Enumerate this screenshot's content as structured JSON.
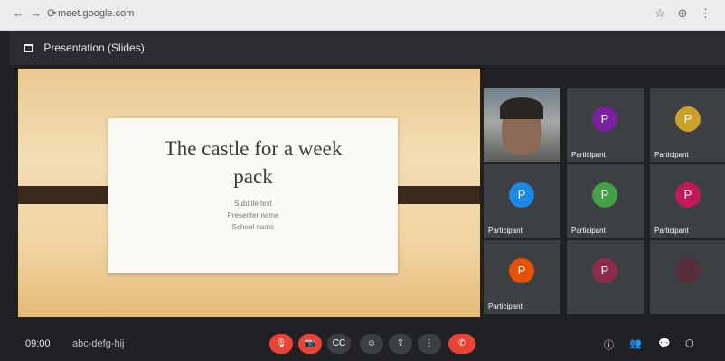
{
  "meet": {
    "presenting_label": "Presentation (Slides)",
    "slide": {
      "title_line1": "The castle for a week",
      "title_line2": "pack",
      "line1": "Subtitle text",
      "line2": "Presenter name",
      "line3": "School name"
    },
    "participants": [
      {
        "name": "",
        "avatar": "",
        "color": "#8a6a55",
        "video": true
      },
      {
        "name": "Participant",
        "avatar": "P",
        "color": "#7b1fa2",
        "video": false
      },
      {
        "name": "Participant",
        "avatar": "P",
        "color": "#c9a227",
        "video": false
      },
      {
        "name": "Participant",
        "avatar": "P",
        "color": "#1e88e5",
        "video": false
      },
      {
        "name": "Participant",
        "avatar": "P",
        "color": "#43a047",
        "video": false
      },
      {
        "name": "Participant",
        "avatar": "P",
        "color": "#c2185b",
        "video": false
      },
      {
        "name": "Participant",
        "avatar": "P",
        "color": "#e65100",
        "video": false
      },
      {
        "name": "",
        "avatar": "P",
        "color": "#8e2a4a",
        "video": false
      },
      {
        "name": "",
        "avatar": "",
        "color": "#5a2d3a",
        "video": false
      }
    ],
    "bottom": {
      "time": "09:00",
      "meeting_code": "abc-defg-hij"
    },
    "controls": [
      {
        "icon": "mic-off-icon",
        "glyph": "🎙",
        "red": true
      },
      {
        "icon": "cam-off-icon",
        "glyph": "📷",
        "red": true
      },
      {
        "icon": "cc-icon",
        "glyph": "CC",
        "red": false
      },
      {
        "icon": "emoji-icon",
        "glyph": "☺",
        "red": false
      },
      {
        "icon": "present-icon",
        "glyph": "⇪",
        "red": false
      },
      {
        "icon": "more-icon",
        "glyph": "⋮",
        "red": false
      },
      {
        "icon": "end-call-icon",
        "glyph": "✆",
        "red": true
      }
    ]
  }
}
